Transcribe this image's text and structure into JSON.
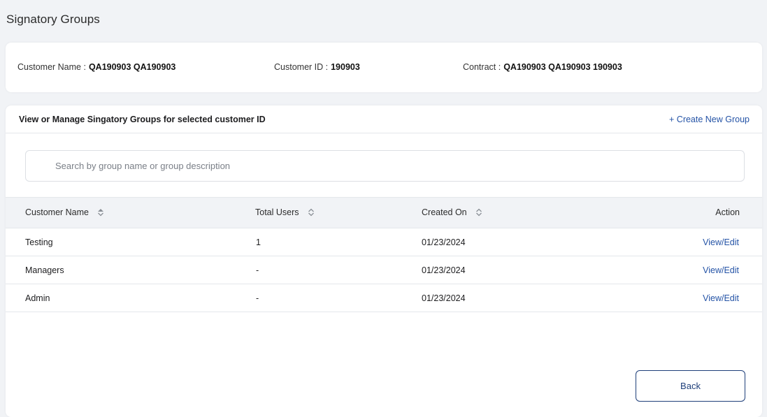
{
  "page": {
    "title": "Signatory Groups"
  },
  "info": {
    "customer_name_label": "Customer Name :",
    "customer_name_value": "QA190903 QA190903",
    "customer_id_label": "Customer ID :",
    "customer_id_value": "190903",
    "contract_label": "Contract :",
    "contract_value": "QA190903 QA190903 190903"
  },
  "main": {
    "heading": "View or Manage Singatory Groups for selected customer ID",
    "create_link": "+ Create New Group",
    "search_placeholder": "Search by group name or group description",
    "table": {
      "columns": [
        "Customer Name",
        "Total Users",
        "Created On",
        "Action"
      ],
      "rows": [
        {
          "name": "Testing",
          "users": "1",
          "created": "01/23/2024",
          "action": "View/Edit"
        },
        {
          "name": "Managers",
          "users": "-",
          "created": "01/23/2024",
          "action": "View/Edit"
        },
        {
          "name": "Admin",
          "users": "-",
          "created": "01/23/2024",
          "action": "View/Edit"
        }
      ]
    },
    "back_label": "Back"
  },
  "colors": {
    "accent": "#2453a6",
    "button_border": "#1f3f7a",
    "background": "#f1f3f6"
  }
}
